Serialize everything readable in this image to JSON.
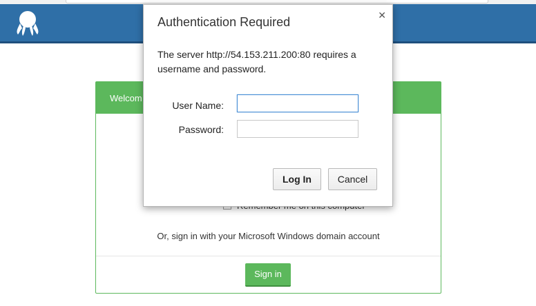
{
  "app": {
    "header_color": "#2f6fa7",
    "logo_icon": "octopus-logo-icon"
  },
  "login_panel": {
    "heading": "Welcom",
    "remember_label": "Remember me on this computer",
    "windows_signin_text": "Or, sign in with your Microsoft Windows domain account",
    "signin_button": "Sign in",
    "accent_color": "#5cb85c"
  },
  "auth_dialog": {
    "title": "Authentication Required",
    "close_icon": "close-icon",
    "message": "The server http://54.153.211.200:80 requires a username and password.",
    "username_label": "User Name:",
    "username_value": "",
    "password_label": "Password:",
    "password_value": "",
    "login_button": "Log In",
    "cancel_button": "Cancel"
  }
}
